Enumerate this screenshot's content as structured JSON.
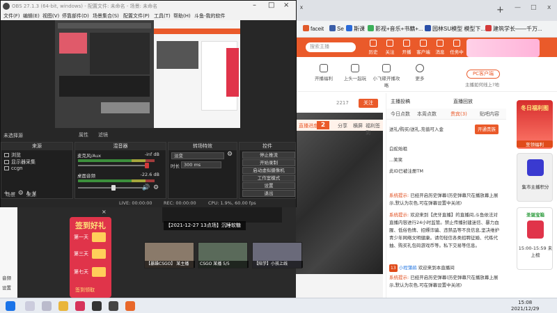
{
  "obs": {
    "title": "OBS 27.1.3 (64-bit, windows) - 配置文件: 未命名 - 场景: 未命名",
    "menu": [
      "文件(F)",
      "编辑(E)",
      "视图(V)",
      "停靠部件(D)",
      "场景集合(S)",
      "配置文件(P)",
      "工具(T)",
      "帮助(H)",
      "斗鱼-我的软件"
    ],
    "scene_label": "未选择源",
    "scene_toolbar": [
      "属性",
      "滤镜"
    ],
    "docks": {
      "sources_header": "来源",
      "sources": [
        "浏览",
        "显示器采集",
        "ccgn"
      ],
      "scenes_tabs": [
        "场景",
        "来源"
      ],
      "mixer_header": "混音器",
      "mixer": [
        {
          "name": "麦克风/Aux",
          "level": "-inf dB"
        },
        {
          "name": "桌面音频",
          "level": "-22.6 dB"
        }
      ],
      "transitions_header": "转场特效",
      "transition_value": "淡变",
      "duration_label": "时长",
      "duration_value": "300 ms",
      "controls_header": "控件",
      "controls": [
        "停止推流",
        "开始录制",
        "启动虚拟摄像机",
        "工作室模式",
        "设置",
        "退出"
      ]
    },
    "status": {
      "live": "LIVE: 00:00:00",
      "rec": "REC: 00:00:00",
      "cpu": "CPU: 1.9%, 60.00 fps"
    }
  },
  "browser": {
    "tabs": [
      "x",
      "+",
      "—",
      "□",
      "x"
    ],
    "bookmarks": [
      "faceit",
      "Se",
      "斯课",
      "影视+音乐+书籍+...",
      "园林SU模型 模型下...",
      "建筑学长——千万..."
    ],
    "search_placeholder": "搜索主播",
    "top_nav": [
      "历史",
      "关注",
      "开播",
      "客户端",
      "消息",
      "任务中心"
    ],
    "sub_nav": [
      "开播福利",
      "上头一起玩",
      "小飞碟开播攻略",
      "更多"
    ],
    "pc_button": "PC客户端",
    "pc_tip": "主播如何线上?地",
    "viewer_count": "2217",
    "follow_button": "关注",
    "progress_label": "直播进度:",
    "progress_value": "2",
    "actions": [
      "分享",
      "横屏",
      "福利签到"
    ],
    "side": {
      "header_left": "主播投稿",
      "header_right": "直播回放",
      "tabs": [
        "今日点数",
        "本周点数",
        "贵宾(3)",
        "贴吧内容"
      ],
      "gift_text": "送礼/购买/送礼,充值可入金",
      "gift_button": "开通贵族",
      "lines": [
        "白蛇始祖",
        "...笑笑",
        "此ID已被注册TM"
      ]
    },
    "chat": [
      {
        "tag": "系统提示:",
        "text": "已经开启历史弹幕(历史弹幕只在播放幕上展示,默认为灰色,可在弹幕设置中关闭)"
      },
      {
        "tag": "系统提示:",
        "text": "欢迎来到【虎牙直播】的直播间,斗鱼依法对直播内容进行24小时监管。禁止传播封建迷信、暴力血腥、低俗色情、招嫖诈骗、违禁品等不良信息,坚决维护青少年网络文明健康。请勿轻信各类招聘征婚、代练代抽、购买礼包码游戏币等。私下交易等信息。"
      },
      {
        "badge": "13",
        "name": "小程蒲鹃",
        "text": "欢迎来到本直播间"
      },
      {
        "tag": "系统提示:",
        "text": "已经开启历史弹幕(历史弹幕只在播放幕上展示,默认为灰色,可在弹幕设置中关闭)"
      }
    ],
    "ads": [
      {
        "title": "冬日福利图",
        "label": "至领福利"
      },
      {
        "title": "",
        "label": "集市主播积分"
      },
      {
        "title": "圣诞宝箱",
        "label": "15:00-15:59 未上榜"
      }
    ]
  },
  "stream": {
    "left_labels": [
      "音频",
      "设置"
    ],
    "gift_panel": {
      "title": "签到好礼",
      "rows": [
        "第一天",
        "第三天",
        "第七天"
      ],
      "footer": "签到领取"
    },
    "topic": "【2021-12-27 13点场】沉睡软糖",
    "thumbs": [
      {
        "caption": "【暴躁CSGO】 某主播"
      },
      {
        "caption": "CSGO 某播 5/5"
      },
      {
        "caption": "【陪学】小孩上线"
      }
    ]
  },
  "taskbar": {
    "time": "15:08",
    "date": "2021/12/29"
  },
  "colors": {
    "huya_orange": "#ea5a2a",
    "obs_bg": "#272727",
    "gift_red": "#e0344a"
  }
}
